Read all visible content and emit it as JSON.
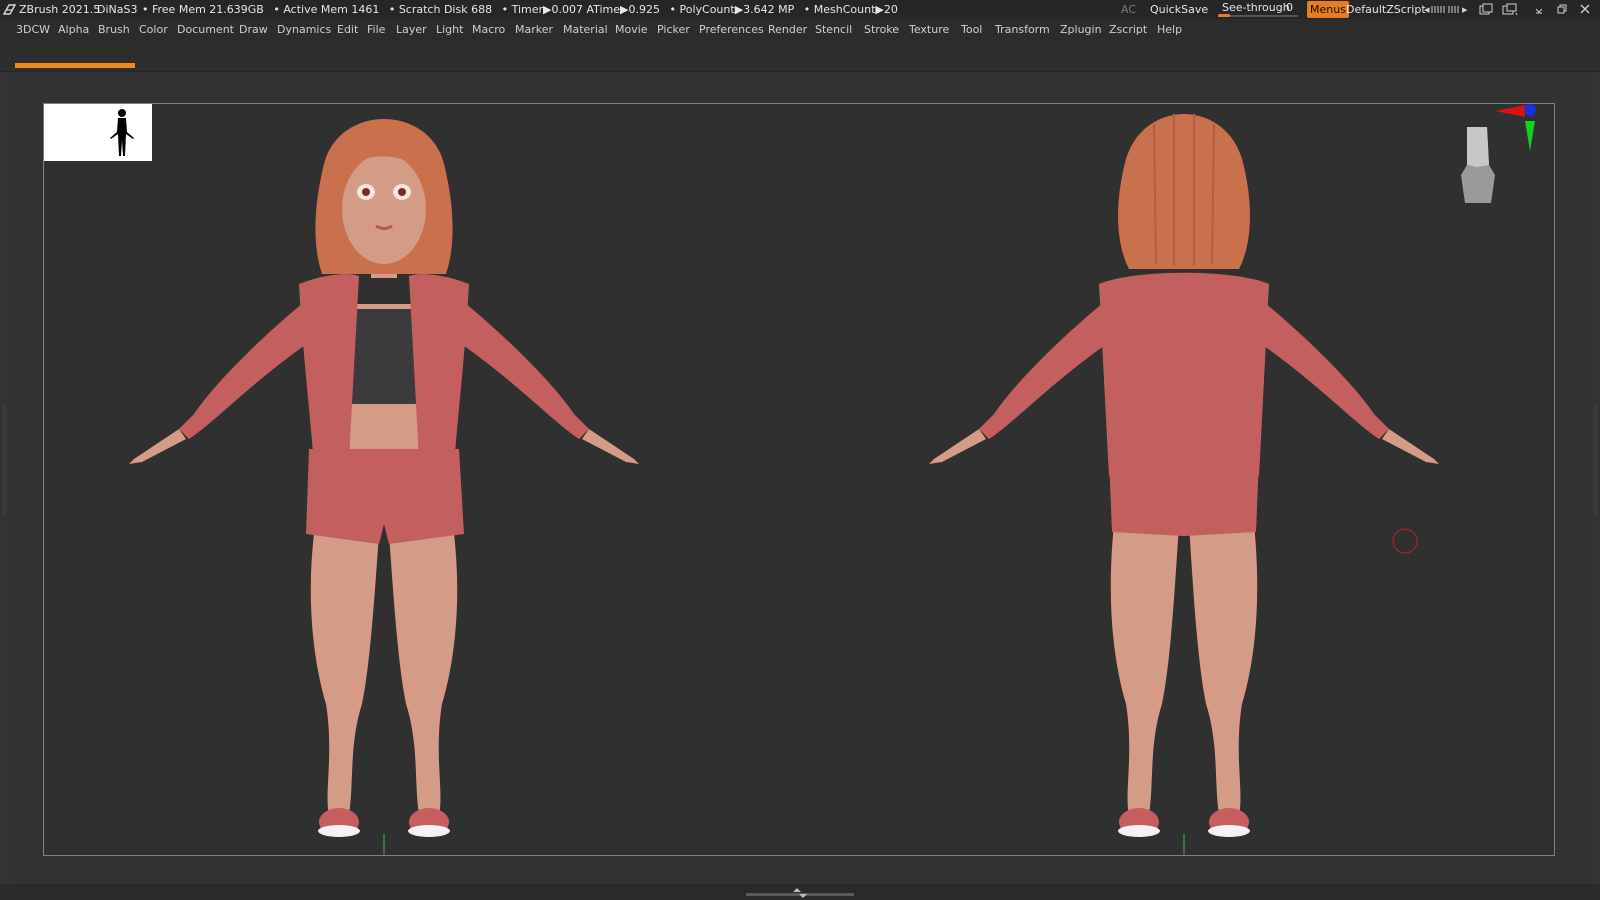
{
  "titlebar": {
    "app_name": "ZBrush 2021.5",
    "project": "DiNaS3",
    "stats": [
      "• Free Mem 21.639GB",
      "• Active Mem 1461",
      "• Scratch Disk 688",
      "• Timer▶0.007 ATime▶0.925",
      "• PolyCount▶3.642 MP",
      "• MeshCount▶20"
    ],
    "ac_label": "AC",
    "quicksave_label": "QuickSave",
    "seethrough_label": "See-through",
    "seethrough_value": "0",
    "seethrough_fraction": 0,
    "menus_label": "Menus",
    "script_label": "DefaultZScript"
  },
  "menubar": {
    "items": [
      "3DCW",
      "Alpha",
      "Brush",
      "Color",
      "Document",
      "Draw",
      "Dynamics",
      "Edit",
      "File",
      "Layer",
      "Light",
      "Macro",
      "Marker",
      "Material",
      "Movie",
      "Picker",
      "Preferences",
      "Render",
      "Stencil",
      "Stroke",
      "Texture",
      "Tool",
      "Transform",
      "Zplugin",
      "Zscript",
      "Help"
    ]
  },
  "progress": {
    "fraction": 1.0
  },
  "colors": {
    "accent": "#e87d1e",
    "skin": "#d49b86",
    "hair": "#c9704d",
    "jacket": "#c45f60",
    "top": "#3b3b3d",
    "sole": "#f2f2f2"
  },
  "icons": {
    "logo": "zbrush-logo-icon",
    "gizmo": "navigation-gizmo-icon",
    "thumbnail": "silhouette-thumbnail",
    "cursor": "brush-cursor-icon"
  }
}
